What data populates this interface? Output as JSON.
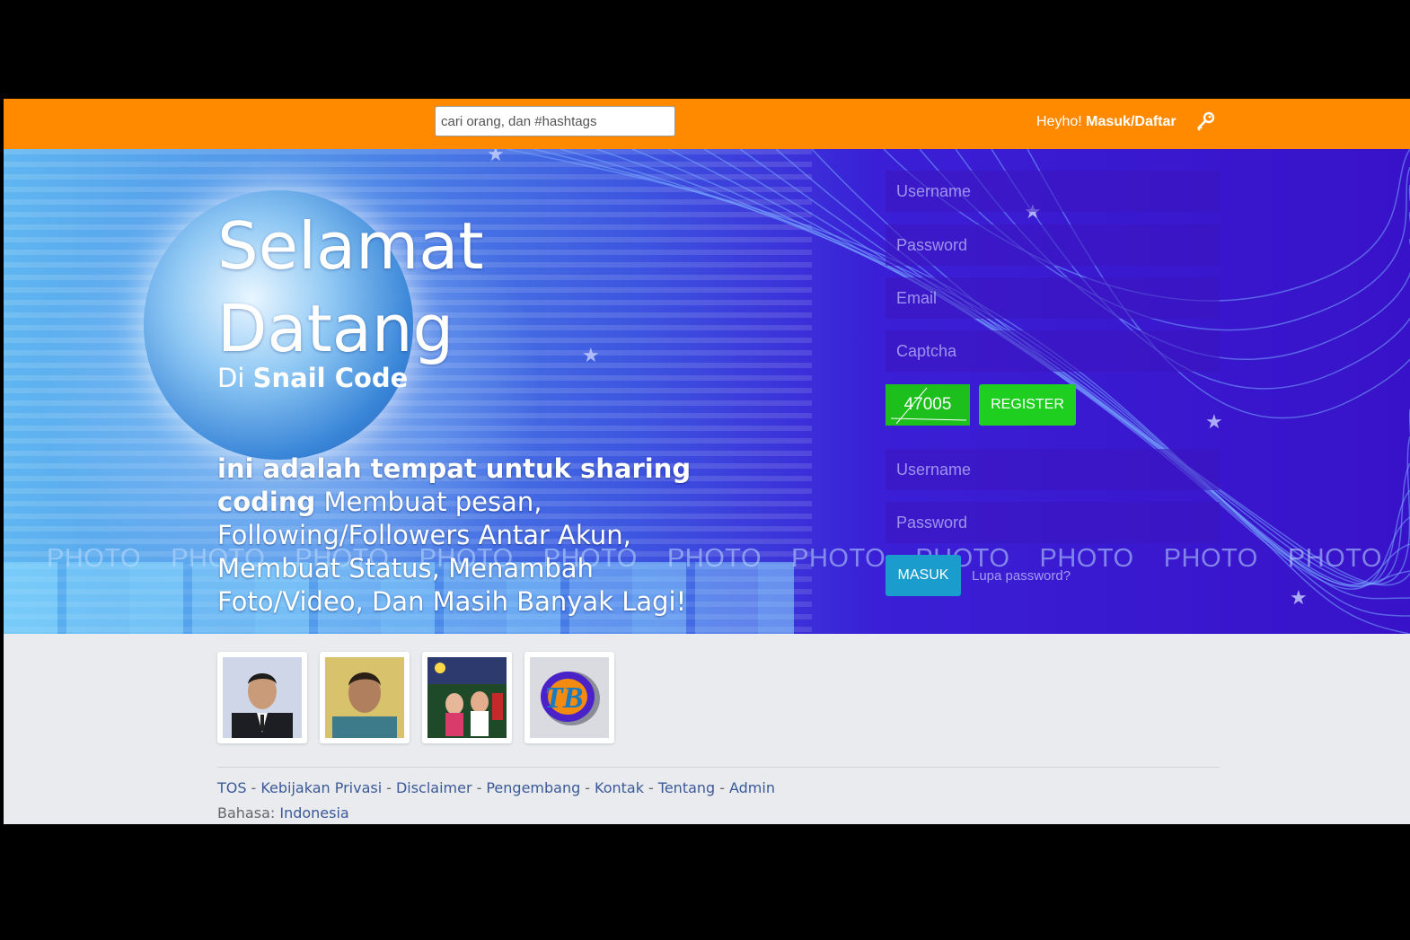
{
  "header": {
    "search_placeholder": "cari orang, dan #hashtags",
    "greeting": "Heyho!",
    "login_link": "Masuk/Daftar",
    "key_icon": "key-icon"
  },
  "hero": {
    "title_line1": "Selamat",
    "title_line2": "Datang",
    "subtitle_prefix": "Di",
    "site_name": "Snail Code",
    "desc_bold": "ini adalah tempat untuk sharing coding",
    "desc_rest": "Membuat pesan, Following/Followers Antar Akun, Membuat Status, Menambah Foto/Video, Dan Masih Banyak Lagi!",
    "photo_watermark": "PHOTO"
  },
  "register": {
    "username_placeholder": "Username",
    "password_placeholder": "Password",
    "email_placeholder": "Email",
    "captcha_placeholder": "Captcha",
    "captcha_code": "47005",
    "register_label": "REGISTER"
  },
  "login": {
    "username_placeholder": "Username",
    "password_placeholder": "Password",
    "masuk_label": "MASUK",
    "forgot_label": "Lupa password?"
  },
  "footer": {
    "links": [
      "TOS",
      "Kebijakan Privasi",
      "Disclaimer",
      "Pengembang",
      "Kontak",
      "Tentang",
      "Admin"
    ],
    "language_label": "Bahasa:",
    "language_value": "Indonesia"
  },
  "colors": {
    "topbar": "#ff8a00",
    "register_green": "#1fcf1f",
    "masuk_blue": "#1a9dcc",
    "link": "#3b5998"
  }
}
